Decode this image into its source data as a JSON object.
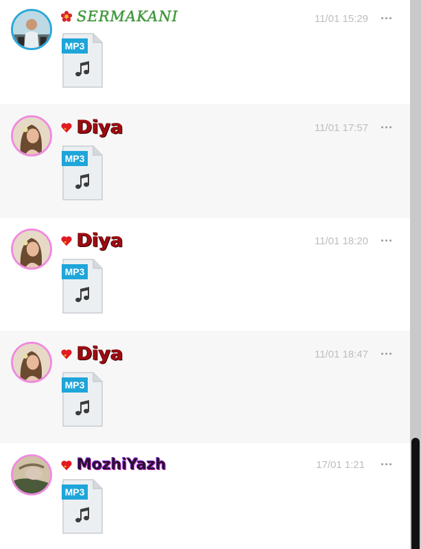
{
  "posts": [
    {
      "author": "SERMAKANI",
      "time": "11/01 15:29",
      "badge": "flower-icon",
      "attachment": {
        "type": "MP3"
      }
    },
    {
      "author": "Diya",
      "time": "11/01 17:57",
      "badge": "heart-icon",
      "attachment": {
        "type": "MP3"
      }
    },
    {
      "author": "Diya",
      "time": "11/01 18:20",
      "badge": "heart-icon",
      "attachment": {
        "type": "MP3"
      }
    },
    {
      "author": "Diya",
      "time": "11/01 18:47",
      "badge": "heart-icon",
      "attachment": {
        "type": "MP3"
      }
    },
    {
      "author": "MozhiYazh",
      "time": "17/01 1:21",
      "badge": "heart-icon",
      "attachment": {
        "type": "MP3"
      }
    }
  ],
  "colors": {
    "accent_blue": "#1ea5d9",
    "avatar_ring_pink": "#ef8be0",
    "avatar_ring_blue": "#29a8d9",
    "alt_row": "#f7f7f7"
  }
}
